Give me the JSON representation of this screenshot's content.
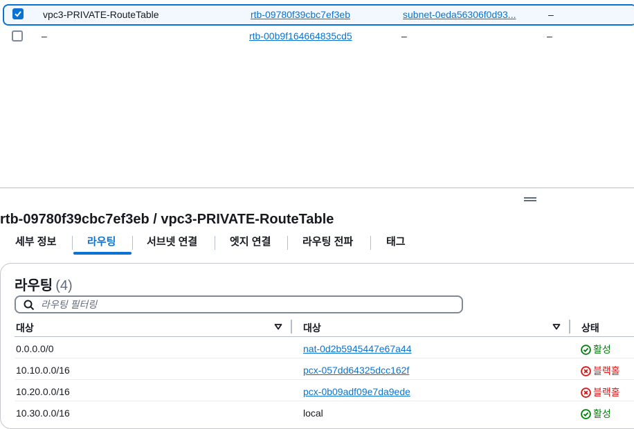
{
  "route_tables": [
    {
      "selected": true,
      "name": "vpc3-PRIVATE-RouteTable",
      "route_table_id": "rtb-09780f39cbc7ef3eb",
      "subnet": "subnet-0eda56306f0d93...",
      "extra": "–"
    },
    {
      "selected": false,
      "name": "–",
      "route_table_id": "rtb-00b9f164664835cd5",
      "subnet": "–",
      "extra": "–"
    }
  ],
  "detail": {
    "title": "rtb-09780f39cbc7ef3eb / vpc3-PRIVATE-RouteTable",
    "tabs": [
      "세부 정보",
      "라우팅",
      "서브넷 연결",
      "엣지 연결",
      "라우팅 전파",
      "태그"
    ],
    "active_tab": "라우팅"
  },
  "routes_panel": {
    "heading": "라우팅",
    "count": "(4)",
    "filter_placeholder": "라우팅 필터링",
    "columns": [
      "대상",
      "대상",
      "상태"
    ],
    "rows": [
      {
        "destination": "0.0.0.0/0",
        "target": "nat-0d2b5945447e67a44",
        "target_is_link": true,
        "status": "활성",
        "status_kind": "active"
      },
      {
        "destination": "10.10.0.0/16",
        "target": "pcx-057dd64325dcc162f",
        "target_is_link": true,
        "status": "블랙홀",
        "status_kind": "blackhole"
      },
      {
        "destination": "10.20.0.0/16",
        "target": "pcx-0b09adf09e7da9ede",
        "target_is_link": true,
        "status": "블랙홀",
        "status_kind": "blackhole"
      },
      {
        "destination": "10.30.0.0/16",
        "target": "local",
        "target_is_link": false,
        "status": "활성",
        "status_kind": "active"
      }
    ]
  },
  "colors": {
    "accent": "#0972d3",
    "active": "#037f0c",
    "blackhole": "#d91515"
  },
  "icons": {
    "checkbox_checked": "check-icon",
    "search": "search-icon",
    "sort": "caret-down-icon",
    "status_active": "check-circle-icon",
    "status_blackhole": "x-circle-icon",
    "resize": "drag-handle-icon"
  }
}
